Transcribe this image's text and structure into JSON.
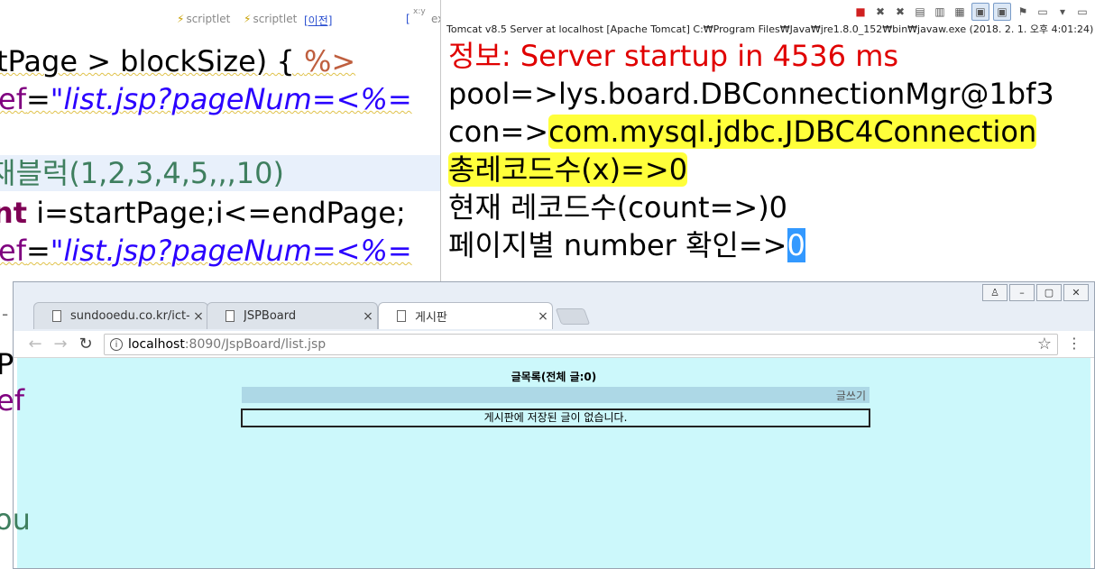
{
  "editor": {
    "hints": [
      "scriptlet",
      "scriptlet",
      "[이전]",
      "[",
      "x:y",
      "ex"
    ],
    "lines": [
      {
        "text": "tPage > blockSize) { "
      },
      {
        "jsp_open": "%>"
      },
      {
        "attr": "ef",
        "eq": "=",
        "str": "\"list.jsp?pageNum=<%="
      },
      {
        "comment": "재블럭(1,2,3,4,5,,,10)"
      },
      {
        "kw": "nt",
        "rest": " i=startPage;i<=endPage;"
      },
      {
        "attr": "ef",
        "eq": "=",
        "str": "\"list.jsp?pageNum=<%="
      }
    ],
    "fragments": [
      "P",
      "ef",
      "ou",
      "-"
    ]
  },
  "console": {
    "title": "Tomcat v8.5 Server at localhost [Apache Tomcat] C:₩Program Files₩Java₩jre1.8.0_152₩bin₩javaw.exe (2018. 2. 1. 오후 4:01:24)",
    "lines": {
      "startup": "정보: Server startup in 4536 ms",
      "pool": "pool=>lys.board.DBConnectionMgr@1bf3",
      "con_label": "con=>",
      "con_value": "com.mysql.jdbc.JDBC4Connection",
      "total": "총레코드수(x)=>0",
      "current": "현재 레코드수(count=>)0",
      "page_label": "페이지별 number 확인=>",
      "page_value": "0"
    }
  },
  "browser": {
    "tabs": [
      {
        "label": "sundooedu.co.kr/ict-new",
        "close": "×"
      },
      {
        "label": "JSPBoard",
        "close": "×"
      },
      {
        "label": "게시판",
        "close": "×"
      }
    ],
    "url_host": "localhost",
    "url_rest": ":8090/JspBoard/list.jsp",
    "page": {
      "heading": "글목록(전체 글:0)",
      "write_link": "글쓰기",
      "empty_message": "게시판에 저장된 글이 없습니다."
    }
  },
  "colors": {
    "viewport_bg": "#ccf8fb",
    "write_bar": "#add8e6",
    "console_red": "#e00000",
    "highlight_yellow": "#ffff3a",
    "selection_blue": "#3399ff"
  }
}
